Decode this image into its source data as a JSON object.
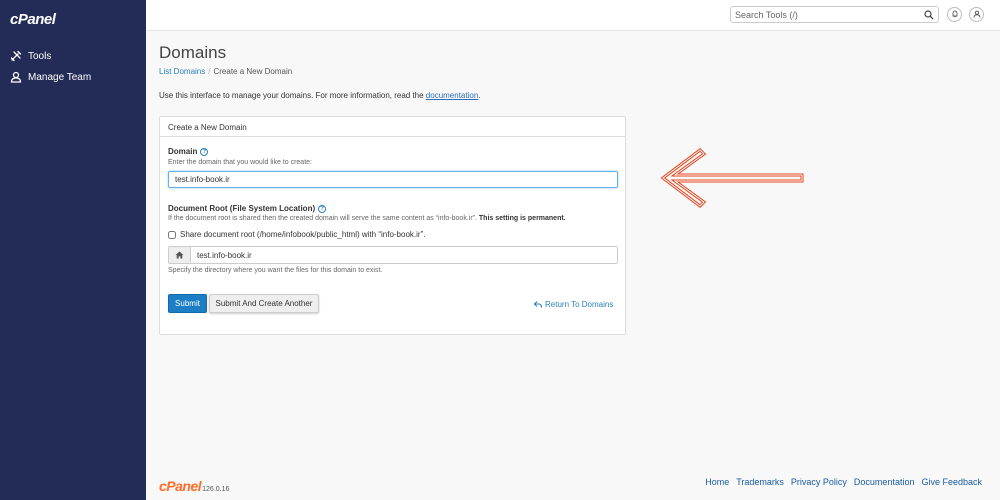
{
  "app": {
    "logo": "cPanel"
  },
  "sidebar": {
    "items": [
      {
        "label": "Tools",
        "icon": "tools-icon"
      },
      {
        "label": "Manage Team",
        "icon": "team-icon"
      }
    ]
  },
  "topbar": {
    "search_placeholder": "Search Tools (/)"
  },
  "page": {
    "title": "Domains",
    "breadcrumb": {
      "link": "List Domains",
      "separator": "/",
      "current": "Create a New Domain"
    },
    "intro_text": "Use this interface to manage your domains. For more information, read the ",
    "intro_link": "documentation",
    "intro_end": "."
  },
  "form": {
    "panel_title": "Create a New Domain",
    "domain_label": "Domain",
    "domain_hint": "Enter the domain that you would like to create:",
    "domain_value": "test.info-book.ir",
    "docroot_label": "Document Root (File System Location)",
    "docroot_hint": "If the document root is shared then the created domain will serve the same content as “info-book.ir”.",
    "docroot_hint_bold": "This setting is permanent.",
    "share_label": "Share document root (/home/infobook/public_html) with “info-book.ir”.",
    "share_checked": false,
    "docroot_value": "test.info-book.ir",
    "docroot_help": "Specify the directory where you want the files for this domain to exist.",
    "submit_label": "Submit",
    "submit_another_label": "Submit And Create Another",
    "return_label": "Return To Domains"
  },
  "footer": {
    "brand": "cPanel",
    "version": "126.0.16",
    "links": [
      "Home",
      "Trademarks",
      "Privacy Policy",
      "Documentation",
      "Give Feedback"
    ]
  },
  "colors": {
    "sidebar": "#232c56",
    "accent": "#1c7ec5",
    "brand_orange": "#ff6c2c",
    "arrow": "#e8461e"
  }
}
